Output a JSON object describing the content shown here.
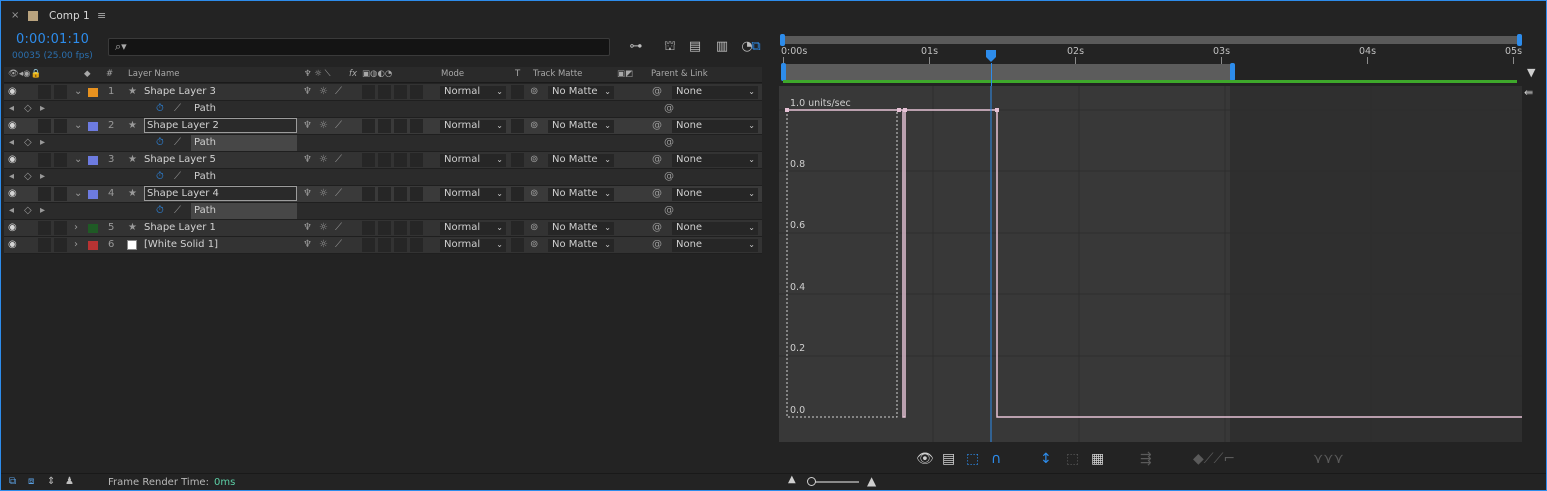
{
  "tab": {
    "close": "×",
    "title": "Comp 1",
    "menu": "≡"
  },
  "timecode": "0:00:01:10",
  "framecount": "00035 (25.00 fps)",
  "search": {
    "icon": "⌕▾"
  },
  "columns": {
    "layer_name": "Layer Name",
    "num": "#",
    "mode": "Mode",
    "t": "T",
    "track_matte": "Track Matte",
    "parent_link": "Parent & Link",
    "fx": "fx"
  },
  "layers": [
    {
      "num": "1",
      "name": "Shape Layer 3",
      "color": "#e8921f",
      "mode": "Normal",
      "matte": "No Matte",
      "parent": "None",
      "expanded": true,
      "sub": "Path"
    },
    {
      "num": "2",
      "name": "Shape Layer 2",
      "color": "#6d7be0",
      "mode": "Normal",
      "matte": "No Matte",
      "parent": "None",
      "expanded": true,
      "sub": "Path"
    },
    {
      "num": "3",
      "name": "Shape Layer 5",
      "color": "#6d7be0",
      "mode": "Normal",
      "matte": "No Matte",
      "parent": "None",
      "expanded": true,
      "sub": "Path"
    },
    {
      "num": "4",
      "name": "Shape Layer 4",
      "color": "#6d7be0",
      "mode": "Normal",
      "matte": "No Matte",
      "parent": "None",
      "expanded": true,
      "sub": "Path"
    },
    {
      "num": "5",
      "name": "Shape Layer 1",
      "color": "#1f5a25",
      "mode": "Normal",
      "matte": "No Matte",
      "parent": "None",
      "expanded": false
    },
    {
      "num": "6",
      "name": "[White Solid 1]",
      "color": "#b83333",
      "mode": "Normal",
      "matte": "No Matte",
      "parent": "None",
      "expanded": false
    }
  ],
  "ruler": [
    "0:00s",
    "01s",
    "02s",
    "03s",
    "04s",
    "05s"
  ],
  "graph": {
    "unit_label": "1.0 units/sec",
    "y_labels": [
      "0.8",
      "0.6",
      "0.4",
      "0.2",
      "0.0"
    ]
  },
  "footer": {
    "label": "Frame Render Time:",
    "value": "0ms"
  },
  "colors": {
    "accent": "#2d8ceb",
    "graph_line": "#e6c2d6",
    "green_bar": "#3ea82b"
  }
}
